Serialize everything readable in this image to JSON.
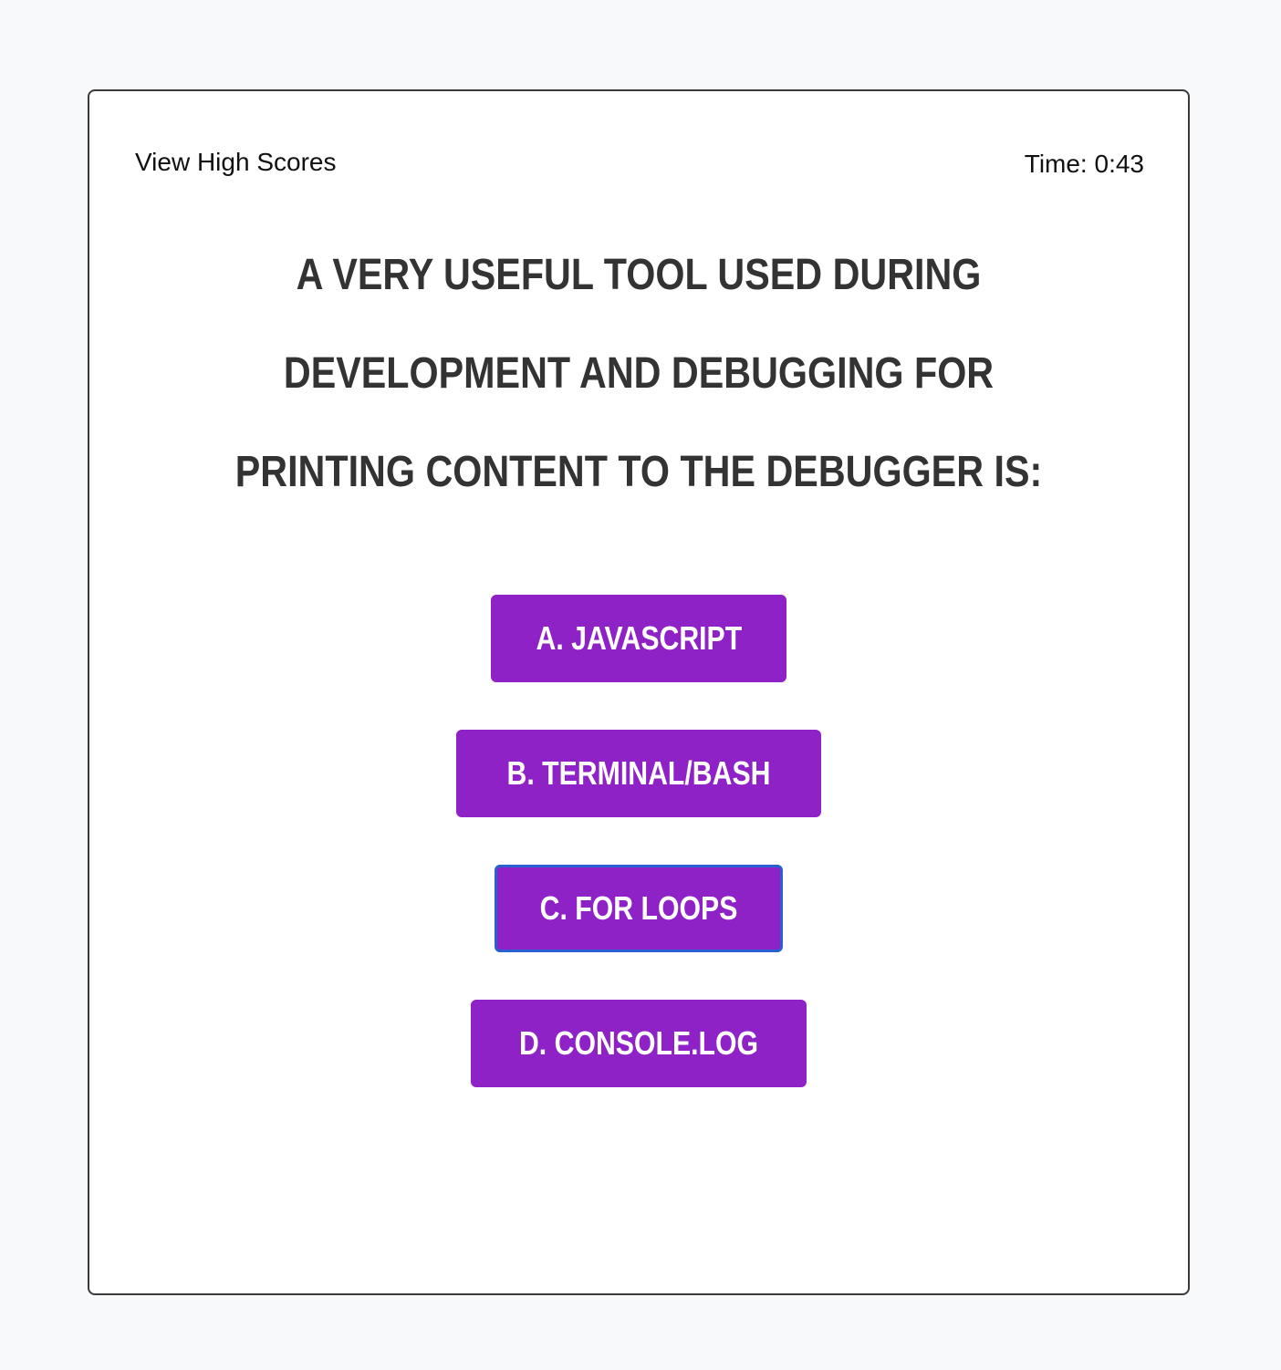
{
  "header": {
    "high_scores_link": "View High Scores",
    "timer_label": "Time: 0:43"
  },
  "question": {
    "text": "A very useful tool used during development and debugging for printing content to the debugger is:"
  },
  "choices": [
    {
      "label": "A. JavaScript"
    },
    {
      "label": "B. Terminal/Bash"
    },
    {
      "label": "C. For Loops"
    },
    {
      "label": "D. Console.log"
    }
  ],
  "colors": {
    "accent": "#8e22c7",
    "focus_ring": "#2a5fd0",
    "question_text": "#333333"
  }
}
